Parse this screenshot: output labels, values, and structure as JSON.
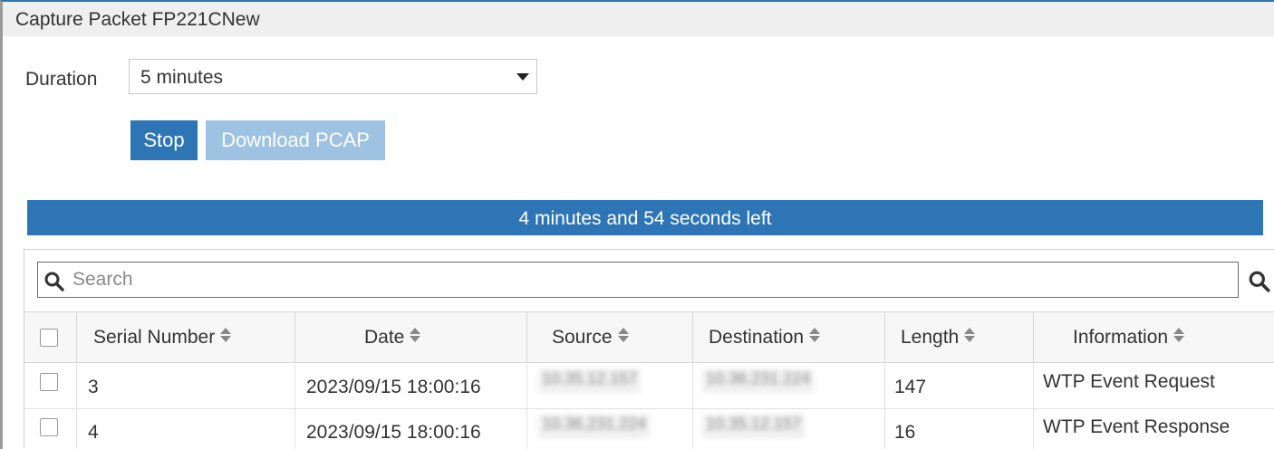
{
  "dialog": {
    "title": "Capture Packet FP221CNew"
  },
  "duration": {
    "label": "Duration",
    "selected": "5 minutes"
  },
  "buttons": {
    "stop": "Stop",
    "download": "Download PCAP"
  },
  "progress": {
    "text": "4 minutes and 54 seconds left",
    "fraction": 1.0
  },
  "search": {
    "placeholder": "Search",
    "value": ""
  },
  "table": {
    "columns": [
      "Serial Number",
      "Date",
      "Source",
      "Destination",
      "Length",
      "Information"
    ],
    "rows": [
      {
        "serial": "3",
        "date": "2023/09/15 18:00:16",
        "source": "10.35.12.157",
        "destination": "10.36.231.224",
        "length": "147",
        "info": "WTP Event Request"
      },
      {
        "serial": "4",
        "date": "2023/09/15 18:00:16",
        "source": "10.36.231.224",
        "destination": "10.35.12.157",
        "length": "16",
        "info": "WTP Event Response"
      }
    ]
  },
  "colors": {
    "accent": "#2e75b6",
    "disabled_button": "#9ec2e2",
    "header_bg": "#f7f7f7",
    "titlebar_bg": "#efefef"
  },
  "icons": {
    "search": "search-icon",
    "sort": "sort-icon",
    "dropdown": "caret-down-icon"
  }
}
